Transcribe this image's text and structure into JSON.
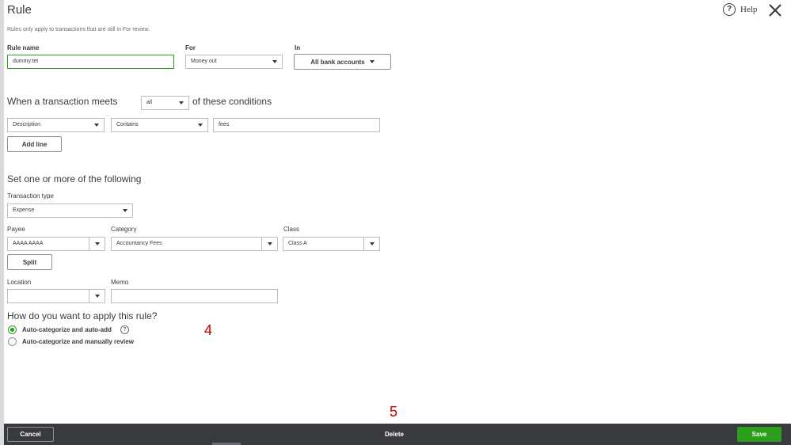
{
  "header": {
    "title": "Rule",
    "subtitle": "Rules only apply to transactions that are still in For review.",
    "help_label": "Help",
    "help_icon": "?"
  },
  "rule_name": {
    "label": "Rule name",
    "value": "dummy.tet"
  },
  "for": {
    "label": "For",
    "value": "Money out"
  },
  "in": {
    "label": "In",
    "value": "All bank accounts"
  },
  "conditions": {
    "prefix": "When a transaction meets",
    "match_value": "all",
    "suffix": "of these conditions",
    "field": "Description",
    "operator": "Contains",
    "text": "fees",
    "add_line_label": "Add line"
  },
  "set": {
    "heading": "Set one or more of the following",
    "transaction_type_label": "Transaction type",
    "transaction_type_value": "Expense",
    "payee_label": "Payee",
    "payee_value": "AAAA AAAA",
    "category_label": "Category",
    "category_value": "Accountancy Fees",
    "class_label": "Class",
    "class_value": "Class A",
    "split_label": "Split",
    "location_label": "Location",
    "location_value": "",
    "memo_label": "Memo",
    "memo_value": ""
  },
  "apply": {
    "heading": "How do you want to apply this rule?",
    "option_1": "Auto-categorize and auto-add",
    "option_2": "Auto-categorize and manually review",
    "selected": 1,
    "info_icon": "?"
  },
  "annotations": {
    "mark_4": "4",
    "mark_5": "5"
  },
  "footer": {
    "cancel_label": "Cancel",
    "delete_label": "Delete",
    "save_label": "Save"
  },
  "colors": {
    "accent": "#2ca01c",
    "footer_bg": "#393a3d",
    "annotation": "#c00000"
  }
}
